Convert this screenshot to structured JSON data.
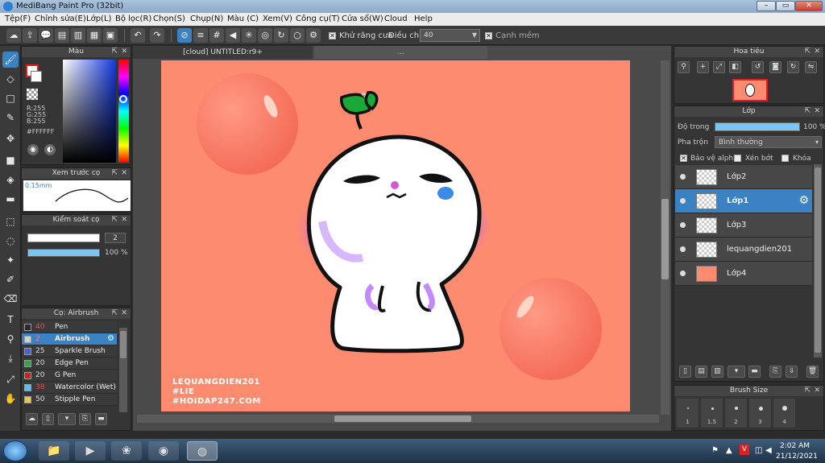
{
  "window": {
    "title": "MediBang Paint Pro (32bit)"
  },
  "menu": [
    "Tệp(F)",
    "Chỉnh sửa(E)",
    "Lớp(L)",
    "Bộ lọc(R)",
    "Chọn(S)",
    "Chụp(N)",
    "Màu (C)",
    "Xem(V)",
    "Công cụ(T)",
    "Cửa sổ(W)",
    "Cloud",
    "Help"
  ],
  "toolbar": {
    "antialias_label": "Khử răng cưa",
    "adjust_label": "Điều chỉnh",
    "adjust_value": "40",
    "sharp_edge_label": "Cạnh mềm"
  },
  "color_panel": {
    "title": "Màu",
    "r": "R:255",
    "g": "G:255",
    "b": "B:255",
    "hex": "#FFFFFF"
  },
  "brush_preview": {
    "title": "Xem trước cọ",
    "size": "0.15mm"
  },
  "brush_control": {
    "title": "Kiểm soát cọ",
    "size": "2",
    "opacity": "100 %",
    "opacity_fraction": 1.0
  },
  "brush_list": {
    "title": "Cọ: Airbrush",
    "items": [
      {
        "size": "40",
        "name": "Pen",
        "color": "#2b2b2b",
        "size_color": "#e35050"
      },
      {
        "size": "2",
        "name": "Airbrush",
        "color": "#d0d0d0",
        "size_color": "#ff7070"
      },
      {
        "size": "25",
        "name": "Sparkle Brush",
        "color": "#4a5de0",
        "size_color": "#dddddd"
      },
      {
        "size": "20",
        "name": "Edge Pen",
        "color": "#2aa84a",
        "size_color": "#dddddd"
      },
      {
        "size": "20",
        "name": "G Pen",
        "color": "#d02020",
        "size_color": "#dddddd"
      },
      {
        "size": "38",
        "name": "Watercolor (Wet)",
        "color": "#5bc0ea",
        "size_color": "#e35050"
      },
      {
        "size": "50",
        "name": "Stipple Pen",
        "color": "#e8d020",
        "size_color": "#dddddd"
      }
    ]
  },
  "document": {
    "tab1": "[cloud] UNTITLED:r9+",
    "tab2": "..."
  },
  "artwork": {
    "watermark_lines": [
      "LEQUANGDIEN201",
      "#LIE",
      "#HOIDAP247.COM"
    ]
  },
  "navigator": {
    "title": "Hoa tiêu"
  },
  "layers": {
    "title": "Lớp",
    "opacity_label": "Độ trong",
    "opacity_value": "100 %",
    "opacity_fraction": 1.0,
    "blend_label": "Pha trộn",
    "blend_value": "Bình thường",
    "protect_alpha": "Bảo vệ alpha",
    "clip": "Xén bớt",
    "lock": "Khóa",
    "items": [
      {
        "name": "Lớp2",
        "selected": false
      },
      {
        "name": "Lớp1",
        "selected": true
      },
      {
        "name": "Lớp3",
        "selected": false
      },
      {
        "name": "lequangdien201",
        "selected": false
      },
      {
        "name": "Lớp4",
        "selected": false
      }
    ]
  },
  "brush_size_panel": {
    "title": "Brush Size",
    "sizes": [
      "1",
      "1.5",
      "2",
      "3",
      "4"
    ]
  },
  "taskbar": {
    "time": "2:02 AM",
    "date": "21/12/2021"
  },
  "colors": {
    "accent": "#3b82c4",
    "canvas_bg": "#fd8b6f"
  }
}
